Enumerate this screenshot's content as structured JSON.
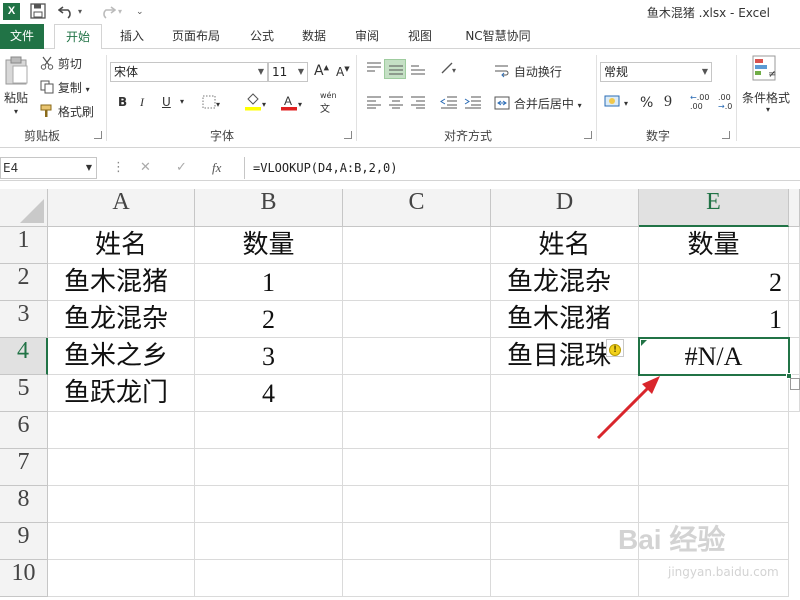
{
  "window": {
    "title": "鱼木混猪 .xlsx - Excel",
    "logo": "X"
  },
  "tabs": [
    "文件",
    "开始",
    "插入",
    "页面布局",
    "公式",
    "数据",
    "审阅",
    "视图",
    "NC智慧协同"
  ],
  "ribbon": {
    "clipboard": {
      "paste": "粘贴",
      "cut": "剪切",
      "copy": "复制",
      "format_painter": "格式刷",
      "label": "剪贴板"
    },
    "font": {
      "name": "宋体",
      "size": "11",
      "grow": "A",
      "shrink": "A",
      "bold": "B",
      "italic": "I",
      "underline": "U",
      "label": "字体",
      "phonetic": "wén"
    },
    "alignment": {
      "wrap": "自动换行",
      "merge": "合并后居中",
      "label": "对齐方式"
    },
    "number": {
      "format": "常规",
      "percent": "%",
      "comma": "9",
      "label": "数字",
      "inc_decimal": ".00",
      "dec_decimal": ".0"
    },
    "styles": {
      "conditional": "条件格式"
    }
  },
  "formula_bar": {
    "name_box": "E4",
    "cancel": "✕",
    "enter": "✓",
    "fx": "fx",
    "formula": "=VLOOKUP(D4,A:B,2,0)"
  },
  "sheet": {
    "columns": [
      "A",
      "B",
      "C",
      "D",
      "E"
    ],
    "rows": [
      "1",
      "2",
      "3",
      "4",
      "5",
      "6",
      "7",
      "8",
      "9",
      "10"
    ],
    "cells": {
      "A1": "姓名",
      "B1": "数量",
      "D1": "姓名",
      "E1": "数量",
      "A2": "鱼木混猪",
      "B2": "1",
      "D2": "鱼龙混杂",
      "E2": "2",
      "A3": "鱼龙混杂",
      "B3": "2",
      "D3": "鱼木混猪",
      "E3": "1",
      "A4": "鱼米之乡",
      "B4": "3",
      "D4": "鱼目混珠",
      "E4": "#N/A",
      "A5": "鱼跃龙门",
      "B5": "4"
    },
    "active_cell": "E4"
  },
  "watermark": {
    "brand": "Bai 经验",
    "url": "jingyan.baidu.com"
  },
  "colors": {
    "accent": "#217346",
    "arrow": "#d9262c"
  }
}
